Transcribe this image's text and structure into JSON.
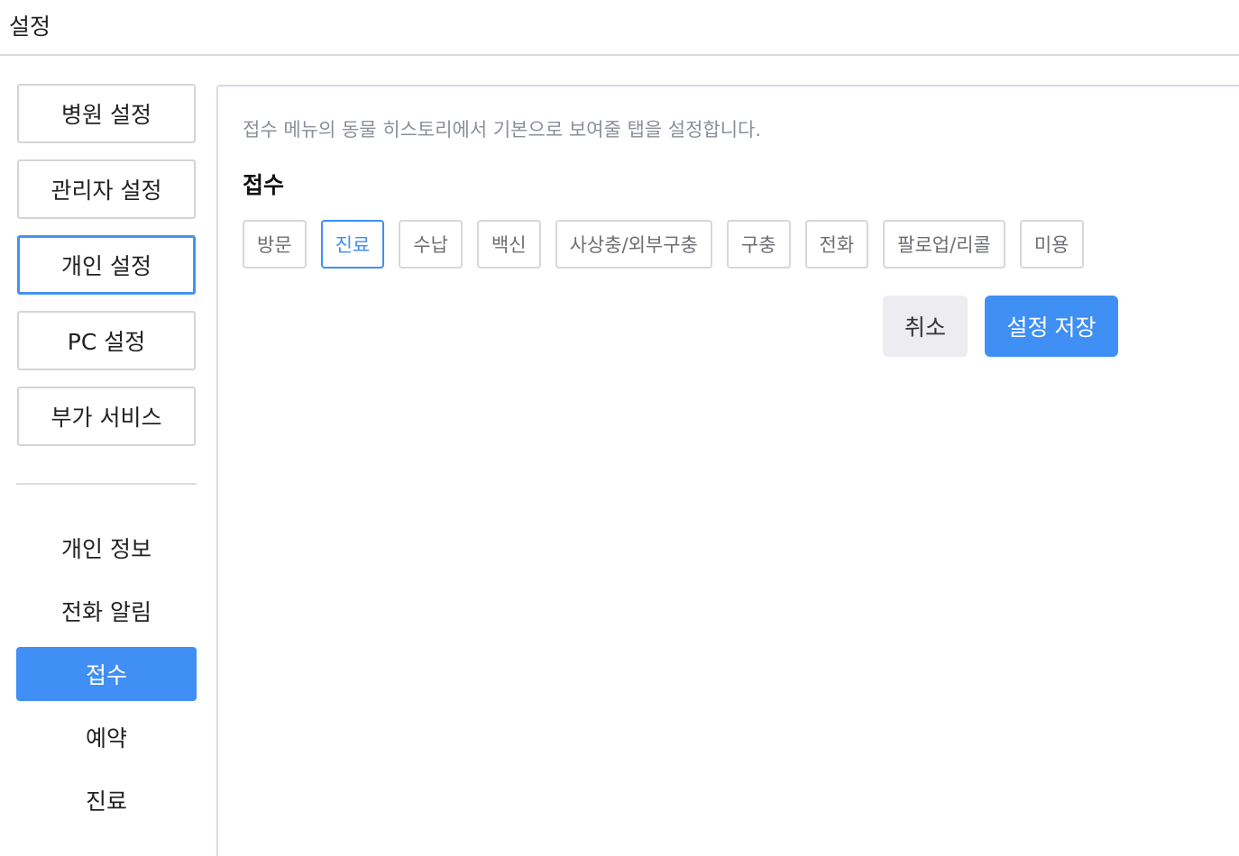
{
  "header": {
    "title": "설정"
  },
  "sidebar": {
    "categories": [
      {
        "label": "병원 설정",
        "active": false
      },
      {
        "label": "관리자 설정",
        "active": false
      },
      {
        "label": "개인 설정",
        "active": true
      },
      {
        "label": "PC 설정",
        "active": false
      },
      {
        "label": "부가 서비스",
        "active": false
      }
    ],
    "sub_items": [
      {
        "label": "개인 정보",
        "active": false
      },
      {
        "label": "전화 알림",
        "active": false
      },
      {
        "label": "접수",
        "active": true
      },
      {
        "label": "예약",
        "active": false
      },
      {
        "label": "진료",
        "active": false
      }
    ]
  },
  "main": {
    "description": "접수 메뉴의 동물 히스토리에서 기본으로 보여줄 탭을 설정합니다.",
    "section_title": "접수",
    "tabs": [
      {
        "label": "방문",
        "selected": false
      },
      {
        "label": "진료",
        "selected": true
      },
      {
        "label": "수납",
        "selected": false
      },
      {
        "label": "백신",
        "selected": false
      },
      {
        "label": "사상충/외부구충",
        "selected": false
      },
      {
        "label": "구충",
        "selected": false
      },
      {
        "label": "전화",
        "selected": false
      },
      {
        "label": "팔로업/리콜",
        "selected": false
      },
      {
        "label": "미용",
        "selected": false
      }
    ],
    "cancel_label": "취소",
    "save_label": "설정 저장"
  },
  "colors": {
    "accent": "#3f8ff5",
    "border": "#d4d4d8",
    "muted_text": "#8a8f99",
    "cancel_bg": "#ececf1"
  }
}
